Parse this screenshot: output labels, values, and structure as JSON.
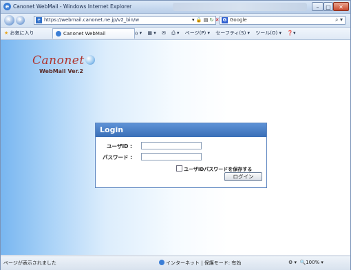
{
  "window": {
    "title": "Canonet WebMail - Windows Internet Explorer"
  },
  "addressbar": {
    "url": "https://webmail.canonet.ne.jp/v2_bin/w",
    "search_placeholder": "Google"
  },
  "favorites": {
    "label": "お気に入り",
    "tab_label": "Canonet WebMail"
  },
  "commandbar": {
    "page": "ページ(P)",
    "safety": "セーフティ(S)",
    "tools": "ツール(O)"
  },
  "logo": {
    "brand": "Canonet",
    "subtitle": "WebMail Ver.2"
  },
  "login": {
    "title": "Login",
    "userid_label": "ユーザID :",
    "password_label": "パスワード :",
    "userid_value": "",
    "password_value": "",
    "remember_label": "ユーザIDパスワードを保存する",
    "submit_label": "ログイン"
  },
  "statusbar": {
    "status": "ページが表示されました",
    "zone": "インターネット | 保護モード: 有効",
    "zoom": "100%"
  }
}
